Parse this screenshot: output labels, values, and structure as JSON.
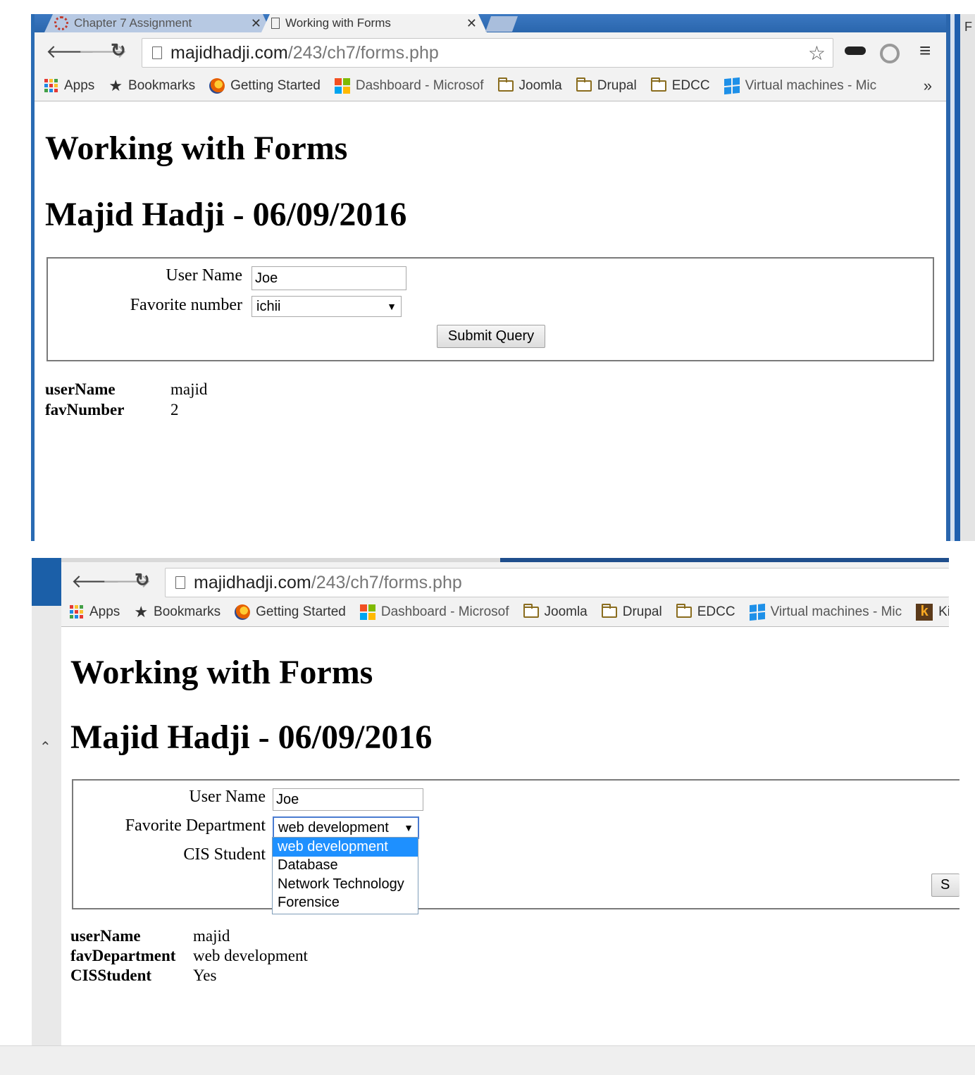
{
  "browser": {
    "tabs": [
      {
        "title": "Chapter 7 Assignment",
        "close": "✕"
      },
      {
        "title": "Working with Forms",
        "close": "✕"
      }
    ],
    "address": {
      "domain": "majidhadji.com",
      "path": "/243/ch7/forms.php"
    },
    "bookmarks": [
      "Apps",
      "Bookmarks",
      "Getting Started",
      "Dashboard - Microsof",
      "Joomla",
      "Drupal",
      "EDCC",
      "Virtual machines - Mic"
    ],
    "bookmarks_second": [
      "Apps",
      "Bookmarks",
      "Getting Started",
      "Dashboard - Microsof",
      "Joomla",
      "Drupal",
      "EDCC",
      "Virtual machines - Mic",
      "Ki"
    ],
    "overflow": "»",
    "right_edge_label": "F"
  },
  "page1": {
    "heading": "Working with Forms",
    "subheading": "Majid Hadji - 06/09/2016",
    "form": {
      "username_label": "User Name",
      "username_value": "Joe",
      "fav_label": "Favorite number",
      "fav_value": "ichii",
      "submit_label": "Submit Query"
    },
    "output": [
      {
        "key": "userName",
        "value": "majid"
      },
      {
        "key": "favNumber",
        "value": "2"
      }
    ]
  },
  "page2": {
    "heading": "Working with Forms",
    "subheading": "Majid Hadji - 06/09/2016",
    "form": {
      "username_label": "User Name",
      "username_value": "Joe",
      "dept_label": "Favorite Department",
      "dept_value": "web development",
      "cis_label": "CIS Student",
      "dept_options": [
        "web development",
        "Database",
        "Network Technology",
        "Forensice"
      ],
      "submit_partial": "S"
    },
    "output": [
      {
        "key": "userName",
        "value": "majid"
      },
      {
        "key": "favDepartment",
        "value": "web development"
      },
      {
        "key": "CISStudent",
        "value": "Yes"
      }
    ]
  },
  "colors": {
    "accent_blue": "#2a66ad",
    "selected_option": "#1e90ff"
  },
  "icons": [
    "back-arrow-icon",
    "forward-arrow-icon",
    "reload-icon",
    "page-icon",
    "star-icon",
    "incognito-glasses-icon",
    "extension-icon",
    "menu-icon",
    "apps-icon",
    "firefox-icon",
    "microsoft-icon",
    "folder-icon",
    "windows-icon",
    "kaltura-icon",
    "chevron-up-icon",
    "dropdown-arrow-icon"
  ]
}
